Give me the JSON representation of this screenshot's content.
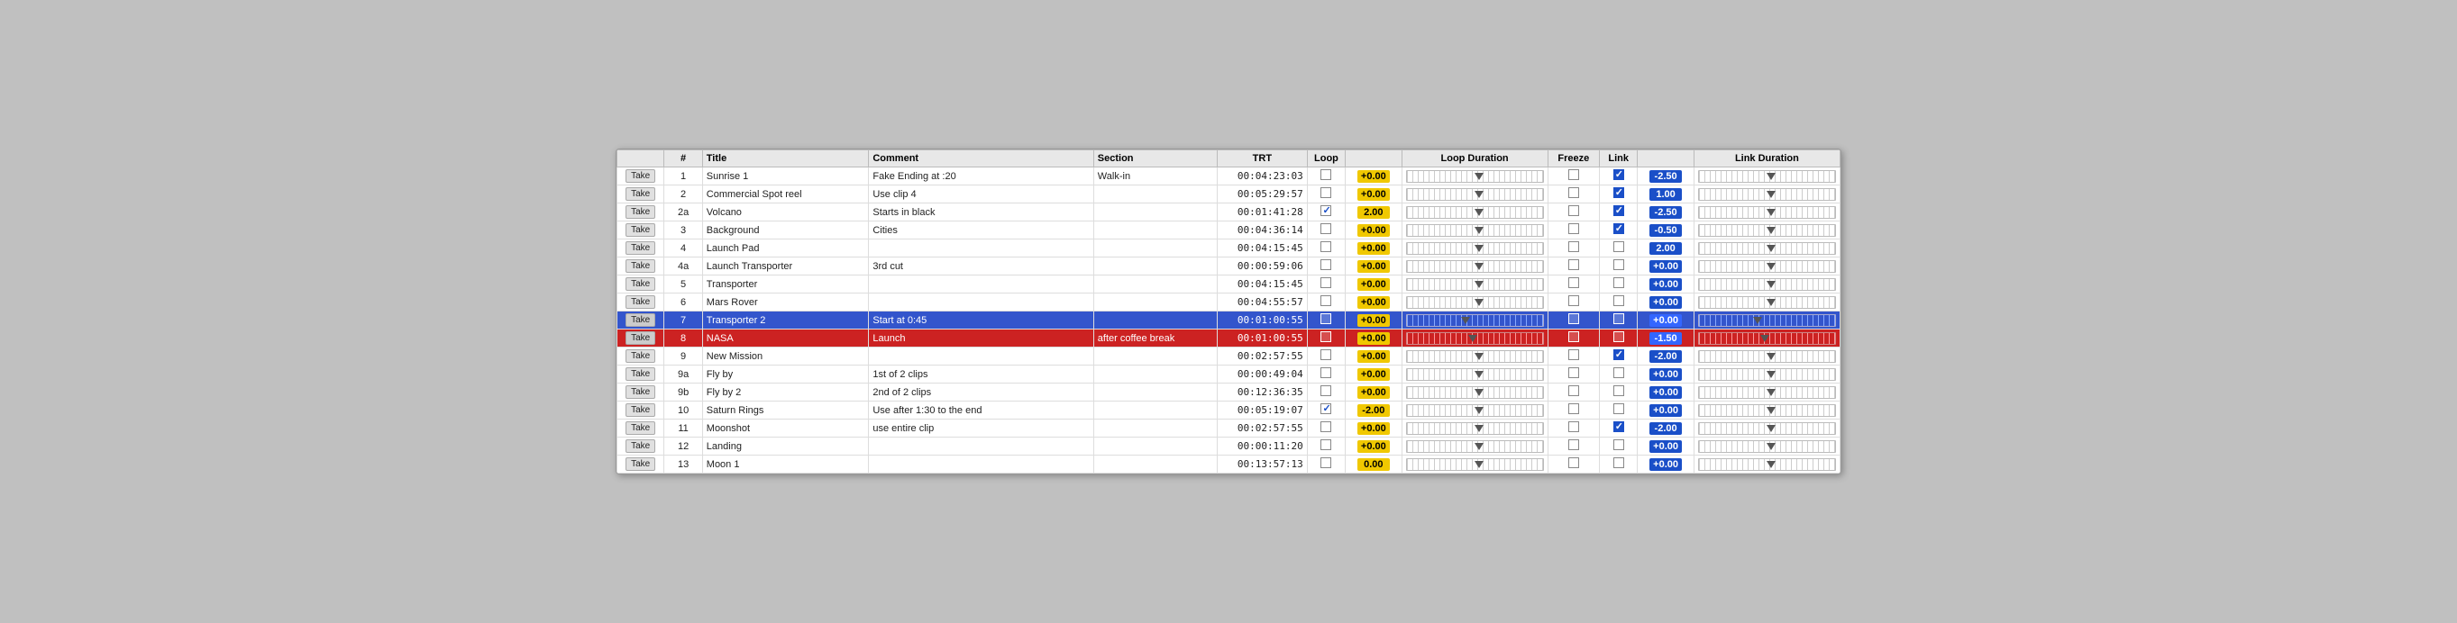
{
  "columns": {
    "take": "",
    "num": "#",
    "title": "Title",
    "comment": "Comment",
    "section": "Section",
    "trt": "TRT",
    "loop": "Loop",
    "loop_val": "",
    "loop_dur": "Loop Duration",
    "freeze": "Freeze",
    "link": "Link",
    "link_val": "",
    "link_dur": "Link Duration"
  },
  "rows": [
    {
      "type": "normal",
      "take": "Take",
      "num": "1",
      "title": "Sunrise 1",
      "comment": "Fake Ending at :20",
      "section": "Walk-in",
      "trt": "00:04:23:03",
      "loop_checked": false,
      "loop_val": "+0.00",
      "loop_val_type": "yellow",
      "loop_thumb": 0.5,
      "freeze_checked": false,
      "link_checked": true,
      "link_val": "-2.50",
      "link_val_type": "blue",
      "link_thumb": 0.5
    },
    {
      "type": "normal",
      "take": "Take",
      "num": "2",
      "title": "Commercial Spot reel",
      "comment": "Use clip 4",
      "section": "",
      "trt": "00:05:29:57",
      "loop_checked": false,
      "loop_val": "+0.00",
      "loop_val_type": "yellow",
      "loop_thumb": 0.5,
      "freeze_checked": false,
      "link_checked": true,
      "link_val": "1.00",
      "link_val_type": "blue",
      "link_thumb": 0.5
    },
    {
      "type": "normal",
      "take": "Take",
      "num": "2a",
      "title": "Volcano",
      "comment": "Starts in black",
      "section": "",
      "trt": "00:01:41:28",
      "loop_checked": true,
      "loop_val": "2.00",
      "loop_val_type": "yellow",
      "loop_thumb": 0.5,
      "freeze_checked": false,
      "link_checked": true,
      "link_val": "-2.50",
      "link_val_type": "blue",
      "link_thumb": 0.5
    },
    {
      "type": "normal",
      "take": "Take",
      "num": "3",
      "title": "Background",
      "comment": "Cities",
      "section": "",
      "trt": "00:04:36:14",
      "loop_checked": false,
      "loop_val": "+0.00",
      "loop_val_type": "yellow",
      "loop_thumb": 0.5,
      "freeze_checked": false,
      "link_checked": true,
      "link_val": "-0.50",
      "link_val_type": "blue",
      "link_thumb": 0.5
    },
    {
      "type": "normal",
      "take": "Take",
      "num": "4",
      "title": "Launch Pad",
      "comment": "",
      "section": "",
      "trt": "00:04:15:45",
      "loop_checked": false,
      "loop_val": "+0.00",
      "loop_val_type": "yellow",
      "loop_thumb": 0.5,
      "freeze_checked": false,
      "link_checked": false,
      "link_val": "2.00",
      "link_val_type": "blue",
      "link_thumb": 0.5
    },
    {
      "type": "normal",
      "take": "Take",
      "num": "4a",
      "title": "Launch Transporter",
      "comment": "3rd cut",
      "section": "",
      "trt": "00:00:59:06",
      "loop_checked": false,
      "loop_val": "+0.00",
      "loop_val_type": "yellow",
      "loop_thumb": 0.5,
      "freeze_checked": false,
      "link_checked": false,
      "link_val": "+0.00",
      "link_val_type": "blue",
      "link_thumb": 0.5
    },
    {
      "type": "normal",
      "take": "Take",
      "num": "5",
      "title": "Transporter",
      "comment": "",
      "section": "",
      "trt": "00:04:15:45",
      "loop_checked": false,
      "loop_val": "+0.00",
      "loop_val_type": "yellow",
      "loop_thumb": 0.5,
      "freeze_checked": false,
      "link_checked": false,
      "link_val": "+0.00",
      "link_val_type": "blue",
      "link_thumb": 0.5
    },
    {
      "type": "normal",
      "take": "Take",
      "num": "6",
      "title": "Mars Rover",
      "comment": "",
      "section": "",
      "trt": "00:04:55:57",
      "loop_checked": false,
      "loop_val": "+0.00",
      "loop_val_type": "yellow",
      "loop_thumb": 0.5,
      "freeze_checked": false,
      "link_checked": false,
      "link_val": "+0.00",
      "link_val_type": "blue",
      "link_thumb": 0.5
    },
    {
      "type": "blue",
      "take": "Take",
      "num": "7",
      "title": "Transporter 2",
      "comment": "Start at 0:45",
      "section": "",
      "trt": "00:01:00:55",
      "loop_checked": false,
      "loop_val": "+0.00",
      "loop_val_type": "yellow",
      "loop_thumb": 0.4,
      "freeze_checked": false,
      "link_checked": false,
      "link_val": "+0.00",
      "link_val_type": "blue",
      "link_thumb": 0.4
    },
    {
      "type": "red",
      "take": "Take",
      "num": "8",
      "title": "NASA",
      "comment": "Launch",
      "section": "after coffee break",
      "trt": "00:01:00:55",
      "loop_checked": false,
      "loop_val": "+0.00",
      "loop_val_type": "yellow",
      "loop_thumb": 0.45,
      "freeze_checked": false,
      "link_checked": false,
      "link_val": "-1.50",
      "link_val_type": "blue",
      "link_thumb": 0.45
    },
    {
      "type": "normal",
      "take": "Take",
      "num": "9",
      "title": "New Mission",
      "comment": "",
      "section": "",
      "trt": "00:02:57:55",
      "loop_checked": false,
      "loop_val": "+0.00",
      "loop_val_type": "yellow",
      "loop_thumb": 0.5,
      "freeze_checked": false,
      "link_checked": true,
      "link_val": "-2.00",
      "link_val_type": "blue",
      "link_thumb": 0.5
    },
    {
      "type": "normal",
      "take": "Take",
      "num": "9a",
      "title": "Fly by",
      "comment": "1st of 2 clips",
      "section": "",
      "trt": "00:00:49:04",
      "loop_checked": false,
      "loop_val": "+0.00",
      "loop_val_type": "yellow",
      "loop_thumb": 0.5,
      "freeze_checked": false,
      "link_checked": false,
      "link_val": "+0.00",
      "link_val_type": "blue",
      "link_thumb": 0.5
    },
    {
      "type": "normal",
      "take": "Take",
      "num": "9b",
      "title": "Fly by 2",
      "comment": "2nd of 2 clips",
      "section": "",
      "trt": "00:12:36:35",
      "loop_checked": false,
      "loop_val": "+0.00",
      "loop_val_type": "yellow",
      "loop_thumb": 0.5,
      "freeze_checked": false,
      "link_checked": false,
      "link_val": "+0.00",
      "link_val_type": "blue",
      "link_thumb": 0.5
    },
    {
      "type": "normal",
      "take": "Take",
      "num": "10",
      "title": "Saturn Rings",
      "comment": "Use after 1:30 to the end",
      "section": "",
      "trt": "00:05:19:07",
      "loop_checked": true,
      "loop_val": "-2.00",
      "loop_val_type": "yellow",
      "loop_thumb": 0.5,
      "freeze_checked": false,
      "link_checked": false,
      "link_val": "+0.00",
      "link_val_type": "blue",
      "link_thumb": 0.5
    },
    {
      "type": "normal",
      "take": "Take",
      "num": "11",
      "title": "Moonshot",
      "comment": "use entire clip",
      "section": "",
      "trt": "00:02:57:55",
      "loop_checked": false,
      "loop_val": "+0.00",
      "loop_val_type": "yellow",
      "loop_thumb": 0.5,
      "freeze_checked": false,
      "link_checked": true,
      "link_val": "-2.00",
      "link_val_type": "blue",
      "link_thumb": 0.5
    },
    {
      "type": "normal",
      "take": "Take",
      "num": "12",
      "title": "Landing",
      "comment": "",
      "section": "",
      "trt": "00:00:11:20",
      "loop_checked": false,
      "loop_val": "+0.00",
      "loop_val_type": "yellow",
      "loop_thumb": 0.5,
      "freeze_checked": false,
      "link_checked": false,
      "link_val": "+0.00",
      "link_val_type": "blue",
      "link_thumb": 0.5
    },
    {
      "type": "normal",
      "take": "Take",
      "num": "13",
      "title": "Moon 1",
      "comment": "",
      "section": "",
      "trt": "00:13:57:13",
      "loop_checked": false,
      "loop_val": "0.00",
      "loop_val_type": "yellow",
      "loop_thumb": 0.5,
      "freeze_checked": false,
      "link_checked": false,
      "link_val": "+0.00",
      "link_val_type": "blue",
      "link_thumb": 0.5
    }
  ]
}
